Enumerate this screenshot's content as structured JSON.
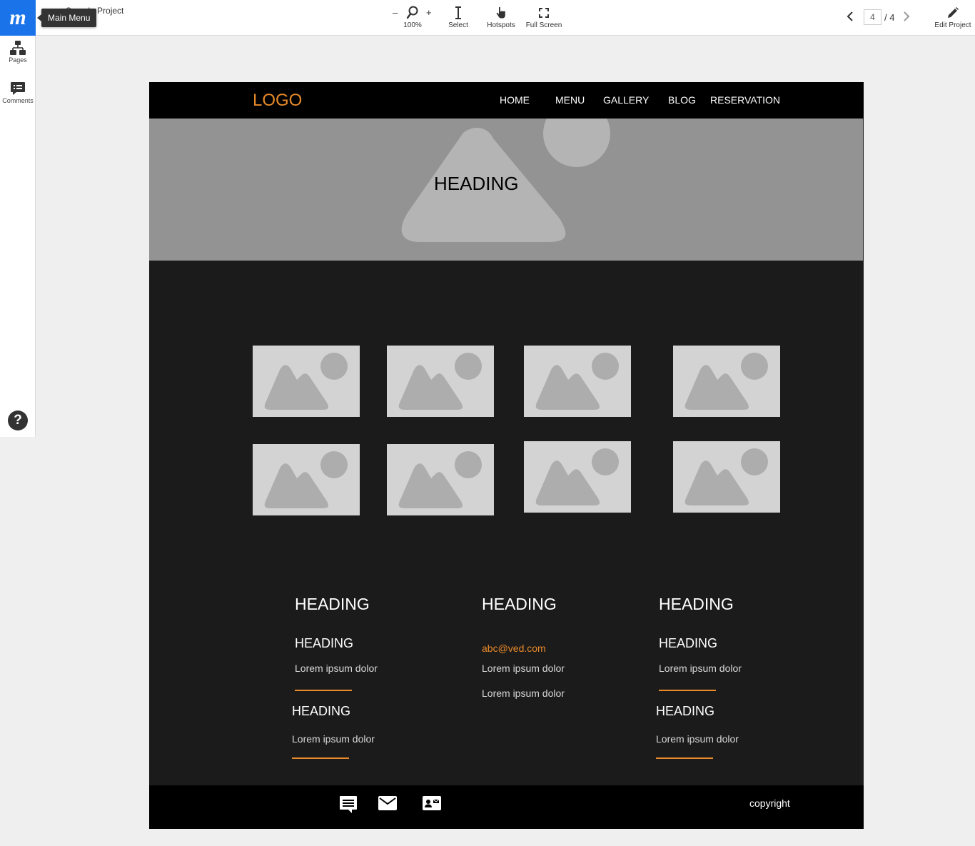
{
  "app": {
    "project_name": "Sample Project",
    "main_menu_tooltip": "Main Menu"
  },
  "toolbar": {
    "zoom_minus": "–",
    "zoom_plus": "+",
    "zoom_level": "100%",
    "select_label": "Select",
    "hotspots_label": "Hotspots",
    "fullscreen_label": "Full Screen",
    "edit_label": "Edit Project"
  },
  "pager": {
    "current": "4",
    "total": "/ 4"
  },
  "sidebar": {
    "pages_label": "Pages",
    "comments_label": "Comments",
    "help_label": "?"
  },
  "site": {
    "logo": "LOGO",
    "nav": [
      "HOME",
      "MENU",
      "GALLERY",
      "BLOG",
      "RESERVATION"
    ],
    "hero_heading": "HEADING",
    "footer_columns": [
      {
        "heading": "HEADING",
        "sub1": "HEADING",
        "text1": "Lorem ipsum dolor",
        "sub2": "HEADING",
        "text2": "Lorem ipsum dolor"
      },
      {
        "heading": "HEADING",
        "email": "abc@ved.com",
        "text1": "Lorem ipsum dolor",
        "text2": "Lorem ipsum dolor"
      },
      {
        "heading": "HEADING",
        "sub1": "HEADING",
        "text1": "Lorem ipsum dolor",
        "sub2": "HEADING",
        "text2": "Lorem ipsum dolor"
      }
    ],
    "copyright": "copyright"
  },
  "colors": {
    "accent": "#e8892a",
    "brand_blue": "#1a73e8",
    "dark_bg": "#1b1b1b",
    "hero_bg": "#939393",
    "placeholder_bg": "#d3d3d3"
  },
  "icons": [
    "magnifier-icon",
    "text-cursor-icon",
    "hand-pointer-icon",
    "fullscreen-icon",
    "chevron-left-icon",
    "chevron-right-icon",
    "pencil-icon",
    "sitemap-icon",
    "comment-icon",
    "help-icon",
    "chat-icon",
    "mail-icon",
    "contact-card-icon",
    "image-placeholder-icon"
  ]
}
